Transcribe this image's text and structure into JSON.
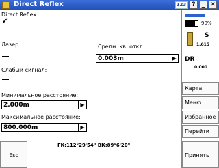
{
  "titlebar": {
    "title": "Direct Reflex",
    "badge": "123",
    "help": "?",
    "minimize": "_",
    "close": "✕"
  },
  "form": {
    "direct_reflex_label": "Direct Reflex:",
    "direct_reflex_checked": "✔",
    "laser_label": "Лазер:",
    "sd_label": "Средн. кв. откл.:",
    "sd_value": "0.003m",
    "weak_signal_label": "Слабый сигнал:",
    "min_dist_label": "Минимальное расстояние:",
    "min_dist_value": "2.000m",
    "max_dist_label": "Максимальное расстояние:",
    "max_dist_value": "800.000m",
    "arrow": "▶"
  },
  "status": {
    "battery_text": "90%",
    "sat_text_1": "S",
    "sat_text_2": "1.615",
    "dr_text_1": "DR",
    "dr_text_2": "0.000"
  },
  "side_menu": {
    "map": "Карта",
    "menu": "Меню",
    "favorites": "Избранное",
    "goto": "Перейти"
  },
  "bottom": {
    "esc": "Esc",
    "coords": "ГК:112°29'54\"  ВК:89°6'20\"",
    "accept": "Принять"
  }
}
